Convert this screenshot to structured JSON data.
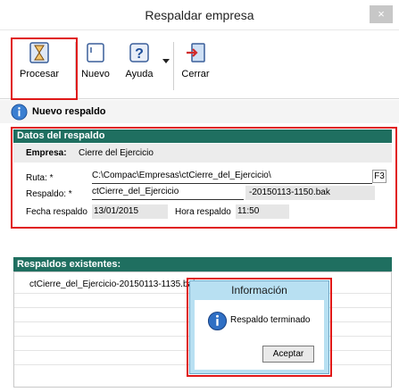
{
  "window": {
    "title": "Respaldar empresa",
    "close_glyph": "×"
  },
  "toolbar": {
    "process_label": "Procesar",
    "new_label": "Nuevo",
    "help_label": "Ayuda",
    "close_label": "Cerrar"
  },
  "new_backup": {
    "label": "Nuevo respaldo"
  },
  "details": {
    "heading": "Datos del respaldo",
    "company_label": "Empresa:",
    "company_value": "Cierre del Ejercicio",
    "path_label": "Ruta: *",
    "path_value": "C:\\Compac\\Empresas\\ctCierre_del_Ejercicio\\",
    "path_key": "F3",
    "backup_label": "Respaldo: *",
    "backup_value": "ctCierre_del_Ejercicio",
    "backup_suffix": "-20150113-1150.bak",
    "date_label": "Fecha respaldo",
    "date_value": "13/01/2015",
    "time_label": "Hora respaldo",
    "time_value": "11:50"
  },
  "existing": {
    "heading": "Respaldos existentes:",
    "items": [
      "ctCierre_del_Ejercicio-20150113-1135.bak"
    ]
  },
  "dialog": {
    "title": "Información",
    "message": "Respaldo terminado",
    "ok_label": "Aceptar"
  },
  "colors": {
    "section_header": "#1f6f60",
    "highlight": "#e01818",
    "dialog_frame": "#b8e0f2"
  }
}
